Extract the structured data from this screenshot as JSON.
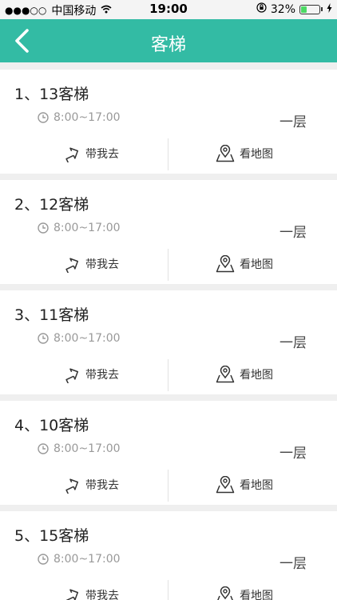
{
  "status_bar": {
    "carrier": "中国移动",
    "time": "19:00",
    "battery_pct": "32%",
    "battery_level": 0.32
  },
  "nav": {
    "title": "客梯"
  },
  "colors": {
    "accent": "#33bba4"
  },
  "items": [
    {
      "name": "1、13客梯",
      "hours": "8:00~17:00",
      "floor": "一层",
      "go_label": "带我去",
      "map_label": "看地图"
    },
    {
      "name": "2、12客梯",
      "hours": "8:00~17:00",
      "floor": "一层",
      "go_label": "带我去",
      "map_label": "看地图"
    },
    {
      "name": "3、11客梯",
      "hours": "8:00~17:00",
      "floor": "一层",
      "go_label": "带我去",
      "map_label": "看地图"
    },
    {
      "name": "4、10客梯",
      "hours": "8:00~17:00",
      "floor": "一层",
      "go_label": "带我去",
      "map_label": "看地图"
    },
    {
      "name": "5、15客梯",
      "hours": "8:00~17:00",
      "floor": "一层",
      "go_label": "带我去",
      "map_label": "看地图"
    }
  ]
}
